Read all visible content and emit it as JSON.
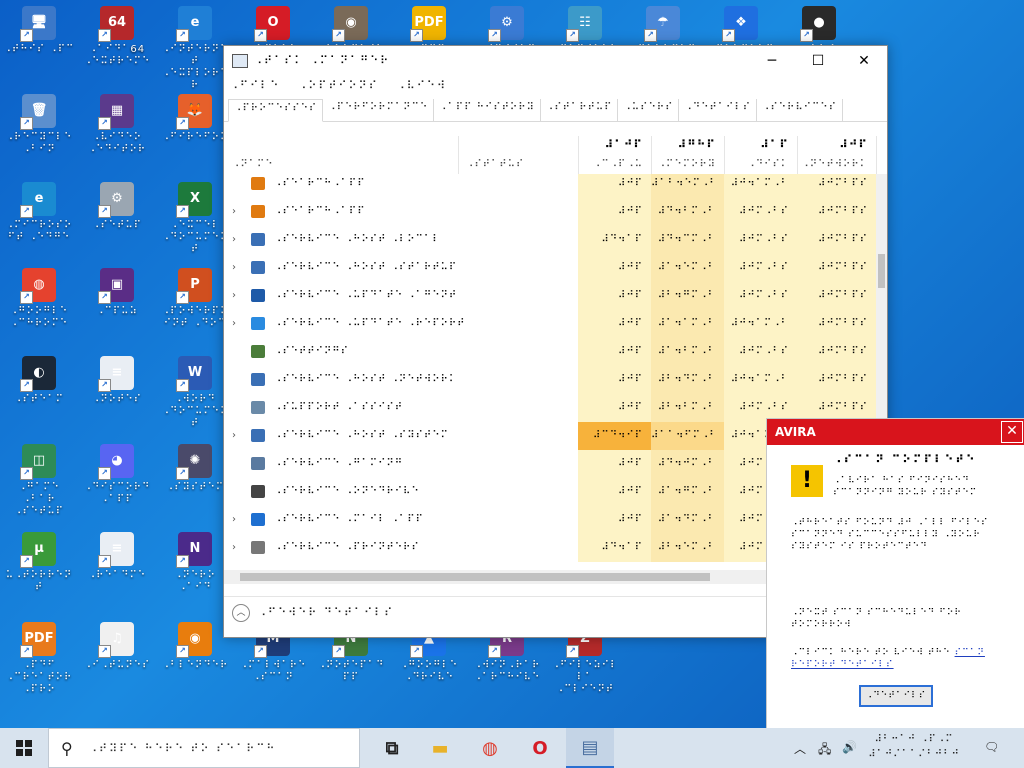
{
  "desktop": {
    "icons": [
      {
        "label": "⠠⠞⠓⠊⠎ ⠠⠏⠉",
        "glyph": "🖥",
        "color": "#3b78c9"
      },
      {
        "label": "⠠⠁⠊⠙⠁64 ⠠⠑⠭⠞⠗⠑⠍⠑",
        "glyph": "64",
        "color": "#b5282b"
      },
      {
        "label": "⠠⠊⠝⠞⠑⠗⠝⠑⠞ ⠠⠑⠭⠏⠇⠕⠗⠑⠗",
        "glyph": "e",
        "color": "#1f7fd6"
      },
      {
        "label": "⠠⠕⠏⠑⠗⠁ ⠠⠃⠗⠕⠺⠎⠑⠗",
        "glyph": "O",
        "color": "#d51c26"
      },
      {
        "label": "⠠⠃⠥⠗⠝⠁⠺⠁⠗⠑",
        "glyph": "◉",
        "color": "#7a6a58"
      },
      {
        "label": "⠠⠏⠙⠋ ⠠⠋⠁⠉⠞⠕⠗⠽",
        "glyph": "PDF",
        "color": "#f0b400"
      },
      {
        "label": "⠠⠎⠽⠎⠞⠑⠍ ⠠⠝⠋⠕",
        "glyph": "⚙",
        "color": "#3a7bd4"
      },
      {
        "label": "⠠⠉⠕⠝⠞⠗⠕⠇ ⠠⠏⠁⠝⠑⠇",
        "glyph": "☷",
        "color": "#3c9ac9"
      },
      {
        "label": "⠠⠏⠁⠗⠁⠛⠕⠝ ⠠⠃⠁⠉⠅⠥⠏",
        "glyph": "☂",
        "color": "#4a88d8"
      },
      {
        "label": "⠠⠙⠗⠕⠏⠃⠕⠭",
        "glyph": "❖",
        "color": "#1f6fe0"
      },
      {
        "label": "⠠⠕⠃⠎ ⠠⠎⠞⠥⠙⠊⠕",
        "glyph": "●",
        "color": "#2a2a2a"
      },
      {
        "label": "⠠⠗⠑⠉⠽⠉⠇⠑ ⠠⠃⠊⠝",
        "glyph": "🗑",
        "color": "#5b8fce"
      },
      {
        "label": "⠠⠧⠊⠙⠑⠕ ⠠⠑⠙⠊⠞⠕⠗",
        "glyph": "▦",
        "color": "#5b3a8c"
      },
      {
        "label": "⠠⠋⠊⠗⠑⠋⠕⠭",
        "glyph": "🦊",
        "color": "#e6602b"
      },
      {
        "label": "⠠⠍⠊⠉⠗⠕⠎⠕⠋⠞ ⠠⠑⠙⠛⠑",
        "glyph": "e",
        "color": "#1a8bd1"
      },
      {
        "label": "⠠⠎⠑⠞⠥⠏",
        "glyph": "⚙",
        "color": "#9aa6b2"
      },
      {
        "label": "⠠⠑⠭⠉⠑⠇ ⠠⠙⠕⠉⠥⠍⠑⠝⠞",
        "glyph": "X",
        "color": "#1d7a3c"
      },
      {
        "label": "⠠⠛⠕⠕⠛⠇⠑ ⠠⠉⠓⠗⠕⠍⠑",
        "glyph": "◍",
        "color": "#e5422e"
      },
      {
        "label": "⠠⠉⠏⠥⠵",
        "glyph": "▣",
        "color": "#5a2d86"
      },
      {
        "label": "⠠⠏⠕⠺⠑⠗⠏⠕⠊⠝⠞ ⠠⠙⠕⠉",
        "glyph": "P",
        "color": "#d04f1f"
      },
      {
        "label": "⠠⠎⠞⠑⠁⠍",
        "glyph": "◐",
        "color": "#1b2838"
      },
      {
        "label": "⠠⠝⠕⠞⠑⠎",
        "glyph": "≡",
        "color": "#e9eef4"
      },
      {
        "label": "⠠⠺⠕⠗⠙ ⠠⠙⠕⠉⠥⠍⠑⠝⠞",
        "glyph": "W",
        "color": "#2b5bb5"
      },
      {
        "label": "⠠⠛⠁⠍⠑ ⠠⠃⠁⠗ ⠠⠎⠑⠞⠥⠏",
        "glyph": "◫",
        "color": "#2e8b57"
      },
      {
        "label": "⠠⠙⠊⠎⠉⠕⠗⠙ ⠠⠁⠏⠏",
        "glyph": "◕",
        "color": "#5865f2"
      },
      {
        "label": "⠠⠎⠽⠎⠞⠑⠍",
        "glyph": "✺",
        "color": "#4a4a6a"
      },
      {
        "label": "⠥⠠⠞⠕⠗⠗⠑⠝⠞",
        "glyph": "µ",
        "color": "#3a9a3a"
      },
      {
        "label": "⠠⠗⠑⠁⠙⠍⠑",
        "glyph": "≡",
        "color": "#e9eef4"
      },
      {
        "label": "⠠⠝⠑⠗⠕ ⠠⠁⠊⠙",
        "glyph": "N",
        "color": "#4b2a8a"
      },
      {
        "label": "⠠⠏⠙⠋ ⠠⠉⠗⠑⠁⠞⠕⠗ ⠠⠏⠗⠕",
        "glyph": "PDF",
        "color": "#e87a1c"
      },
      {
        "label": "⠠⠊⠠⠞⠥⠝⠑⠎",
        "glyph": "♫",
        "color": "#f0f0f0"
      },
      {
        "label": "⠠⠃⠇⠑⠝⠙⠑⠗",
        "glyph": "◉",
        "color": "#e87d0d"
      },
      {
        "label": "⠠⠍⠁⠇⠺⠁⠗⠑ ⠠⠎⠉⠁⠝",
        "glyph": "M",
        "color": "#1e3c78"
      },
      {
        "label": "⠠⠝⠕⠞⠑⠏⠁⠙⠏⠏",
        "glyph": "N",
        "color": "#3d7a3d"
      },
      {
        "label": "⠠⠛⠕⠕⠛⠇⠑ ⠠⠙⠗⠊⠧⠑",
        "glyph": "▲",
        "color": "#1a73e8"
      },
      {
        "label": "⠠⠺⠊⠝⠠⠗⠁⠗ ⠠⠁⠗⠉⠓⠊⠧⠑",
        "glyph": "R",
        "color": "#7a3a8a"
      },
      {
        "label": "⠠⠋⠊⠇⠑⠵⠊⠇⠇⠁ ⠠⠉⠇⠊⠑⠝⠞",
        "glyph": "Z",
        "color": "#b52a2a"
      }
    ]
  },
  "taskmanager": {
    "title": "⠠⠞⠁⠎⠅ ⠠⠍⠁⠝⠁⠛⠑⠗",
    "controls": {
      "minimize": "─",
      "maximize": "☐",
      "close": "✕"
    },
    "menu": [
      "⠠⠋⠊⠇⠑",
      "⠠⠕⠏⠞⠊⠕⠝⠎",
      "⠠⠧⠊⠑⠺"
    ],
    "tabs": [
      "⠠⠏⠗⠕⠉⠑⠎⠎⠑⠎",
      "⠠⠏⠑⠗⠋⠕⠗⠍⠁⠝⠉⠑",
      "⠠⠁⠏⠏ ⠓⠊⠎⠞⠕⠗⠽",
      "⠠⠎⠞⠁⠗⠞⠥⠏",
      "⠠⠥⠎⠑⠗⠎",
      "⠠⠙⠑⠞⠁⠊⠇⠎",
      "⠠⠎⠑⠗⠧⠊⠉⠑⠎"
    ],
    "columns": {
      "name": "⠠⠝⠁⠍⠑",
      "status": "⠠⠎⠞⠁⠞⠥⠎",
      "cpu": {
        "pct": "⠼⠁⠚⠏",
        "label": "⠠⠉⠠⠏⠠⠥"
      },
      "memory": {
        "pct": "⠼⠛⠓⠏",
        "label": "⠠⠍⠑⠍⠕⠗⠽"
      },
      "disk": {
        "pct": "⠼⠁⠏",
        "label": "⠠⠙⠊⠎⠅"
      },
      "network": {
        "pct": "⠼⠚⠏",
        "label": "⠠⠝⠑⠞⠺⠕⠗⠅"
      }
    },
    "rows": [
      {
        "name": "⠠⠎⠑⠁⠗⠉⠓⠠⠁⠏⠏",
        "cpu": "⠼⠚⠏",
        "mem": "⠼⠁⠃⠲⠑⠍⠠⠃",
        "disk": "⠼⠚⠲⠁⠍⠠⠃",
        "net": "⠼⠚⠍⠃⠏⠎",
        "expand": false,
        "icon": "#e07a10"
      },
      {
        "name": "⠠⠎⠑⠁⠗⠉⠓⠠⠁⠏⠏",
        "cpu": "⠼⠚⠏",
        "mem": "⠼⠙⠲⠃⠍⠠⠃",
        "disk": "⠼⠚⠍⠠⠃⠎",
        "net": "⠼⠚⠍⠃⠏⠎",
        "expand": true,
        "icon": "#e07a10"
      },
      {
        "name": "⠠⠎⠑⠗⠧⠊⠉⠑ ⠠⠓⠕⠎⠞ ⠠⠇⠕⠉⠁⠇",
        "cpu": "⠼⠙⠲⠁⠏",
        "mem": "⠼⠙⠲⠉⠍⠠⠃",
        "disk": "⠼⠚⠍⠠⠃⠎",
        "net": "⠼⠚⠍⠃⠏⠎",
        "expand": true,
        "icon": "#3a6fb5"
      },
      {
        "name": "⠠⠎⠑⠗⠧⠊⠉⠑ ⠠⠓⠕⠎⠞ ⠠⠎⠞⠁⠗⠞⠥⠏",
        "cpu": "⠼⠚⠏",
        "mem": "⠼⠁⠲⠑⠍⠠⠃",
        "disk": "⠼⠚⠍⠠⠃⠎",
        "net": "⠼⠚⠍⠃⠏⠎",
        "expand": true,
        "icon": "#3a6fb5"
      },
      {
        "name": "⠠⠎⠑⠗⠧⠊⠉⠑ ⠠⠥⠏⠙⠁⠞⠑ ⠠⠁⠛⠑⠝⠞",
        "cpu": "⠼⠚⠏",
        "mem": "⠼⠃⠲⠛⠍⠠⠃",
        "disk": "⠼⠚⠍⠠⠃⠎",
        "net": "⠼⠚⠍⠃⠏⠎",
        "expand": true,
        "icon": "#1e5aa8"
      },
      {
        "name": "⠠⠎⠑⠗⠧⠊⠉⠑ ⠠⠥⠏⠙⠁⠞⠑ ⠠⠗⠑⠏⠕⠗⠞",
        "cpu": "⠼⠚⠏",
        "mem": "⠼⠁⠲⠁⠍⠠⠃",
        "disk": "⠼⠚⠲⠁⠍⠠⠃",
        "net": "⠼⠚⠍⠃⠏⠎",
        "expand": true,
        "icon": "#2a8be0"
      },
      {
        "name": "⠠⠎⠑⠞⠞⠊⠝⠛⠎",
        "cpu": "⠼⠚⠏",
        "mem": "⠼⠁⠲⠃⠍⠠⠃",
        "disk": "⠼⠚⠍⠠⠃⠎",
        "net": "⠼⠚⠍⠃⠏⠎",
        "expand": false,
        "icon": "#4b7d3a"
      },
      {
        "name": "⠠⠎⠑⠗⠧⠊⠉⠑ ⠠⠓⠕⠎⠞ ⠠⠝⠑⠞⠺⠕⠗⠅",
        "cpu": "⠼⠚⠏",
        "mem": "⠼⠃⠲⠙⠍⠠⠃",
        "disk": "⠼⠚⠲⠁⠍⠠⠃",
        "net": "⠼⠚⠍⠃⠏⠎",
        "expand": false,
        "icon": "#3a6fb5"
      },
      {
        "name": "⠠⠎⠥⠏⠏⠕⠗⠞ ⠠⠁⠎⠎⠊⠎⠞",
        "cpu": "⠼⠚⠏",
        "mem": "⠼⠃⠲⠃⠍⠠⠃",
        "disk": "⠼⠚⠍⠠⠃⠎",
        "net": "⠼⠚⠍⠃⠏⠎",
        "expand": false,
        "icon": "#6a8aa8"
      },
      {
        "name": "⠠⠎⠑⠗⠧⠊⠉⠑ ⠠⠓⠕⠎⠞ ⠠⠎⠽⠎⠞⠑⠍",
        "cpu": "⠼⠉⠙⠲⠊⠏",
        "mem": "⠼⠁⠁⠲⠋⠍⠠⠃",
        "disk": "⠼⠚⠲⠁⠍⠠⠃",
        "net": "⠼⠚⠍⠃⠏⠎",
        "expand": true,
        "icon": "#3a6fb5",
        "hot": true
      },
      {
        "name": "⠠⠎⠑⠗⠧⠊⠉⠑ ⠠⠛⠁⠍⠊⠝⠛",
        "cpu": "⠼⠚⠏",
        "mem": "⠼⠙⠲⠚⠍⠠⠃",
        "disk": "⠼⠚⠍⠠⠃⠎",
        "net": "⠼⠚⠍⠃⠏⠎",
        "expand": false,
        "icon": "#5a7aa0"
      },
      {
        "name": "⠠⠎⠑⠗⠧⠊⠉⠑ ⠠⠕⠝⠑⠙⠗⠊⠧⠑",
        "cpu": "⠼⠚⠏",
        "mem": "⠼⠁⠲⠛⠍⠠⠃",
        "disk": "⠼⠚⠍⠠⠃⠎",
        "net": "⠼⠚⠍⠃⠏⠎",
        "expand": false,
        "icon": "#444"
      },
      {
        "name": "⠠⠎⠑⠗⠧⠊⠉⠑ ⠠⠍⠁⠊⠇ ⠠⠁⠏⠏",
        "cpu": "⠼⠚⠏",
        "mem": "⠼⠁⠲⠙⠍⠠⠃",
        "disk": "⠼⠚⠍⠠⠃⠎",
        "net": "⠼⠚⠍⠃⠏⠎",
        "expand": true,
        "icon": "#1e6fd0"
      },
      {
        "name": "⠠⠎⠑⠗⠧⠊⠉⠑ ⠠⠏⠗⠊⠝⠞⠑⠗⠎",
        "cpu": "⠼⠙⠲⠁⠏",
        "mem": "⠼⠃⠲⠑⠍⠠⠃",
        "disk": "⠼⠚⠍⠠⠃⠎",
        "net": "⠼⠚⠍⠃⠏⠎",
        "expand": true,
        "icon": "#777"
      }
    ],
    "footer": "⠠⠋⠑⠺⠑⠗ ⠙⠑⠞⠁⠊⠇⠎"
  },
  "avira": {
    "brand": "AVIRA",
    "close": "✕",
    "title": "⠠⠎⠉⠁⠝ ⠉⠕⠍⠏⠇⠑⠞⠑",
    "intro": "⠠⠁⠧⠊⠗⠁ ⠓⠁⠎ ⠋⠊⠝⠊⠎⠓⠑⠙ ⠎⠉⠁⠝⠝⠊⠝⠛ ⠽⠕⠥⠗ ⠎⠽⠎⠞⠑⠍",
    "body1": "⠠⠞⠓⠗⠑⠁⠞⠎ ⠋⠕⠥⠝⠙ ⠼⠚ ⠠⠁⠇⠇ ⠋⠊⠇⠑⠎ ⠎⠉⠁⠝⠝⠑⠙ ⠎⠥⠉⠉⠑⠎⠎⠋⠥⠇⠇⠽ ⠠⠽⠕⠥⠗ ⠎⠽⠎⠞⠑⠍ ⠊⠎ ⠏⠗⠕⠞⠑⠉⠞⠑⠙",
    "body2": "⠠⠝⠑⠭⠞ ⠎⠉⠁⠝ ⠎⠉⠓⠑⠙⠥⠇⠑⠙ ⠋⠕⠗ ⠞⠕⠍⠕⠗⠗⠕⠺",
    "body3": "⠠⠉⠇⠊⠉⠅ ⠓⠑⠗⠑ ⠞⠕ ⠧⠊⠑⠺ ⠞⠓⠑",
    "link": "⠎⠉⠁⠝ ⠗⠑⠏⠕⠗⠞ ⠙⠑⠞⠁⠊⠇⠎",
    "button": "⠠⠙⠑⠞⠁⠊⠇⠎"
  },
  "taskbar": {
    "search_placeholder": "⠠⠞⠽⠏⠑ ⠓⠑⠗⠑ ⠞⠕ ⠎⠑⠁⠗⠉⠓",
    "apps": [
      {
        "name": "task-view",
        "glyph": "⧉",
        "color": "#222"
      },
      {
        "name": "file-explorer",
        "glyph": "▬",
        "color": "#e8b22a"
      },
      {
        "name": "chrome",
        "glyph": "◍",
        "color": "#de3b2c"
      },
      {
        "name": "opera",
        "glyph": "O",
        "color": "#d51c26"
      },
      {
        "name": "task-manager",
        "glyph": "▤",
        "color": "#4a6fa0"
      }
    ],
    "tray": {
      "chevron": "︿",
      "network": "🖧",
      "volume": "🔊",
      "notifications": "🗨"
    },
    "clock": {
      "time": "⠼⠃⠒⠁⠚ ⠠⠏⠠⠍",
      "date": "⠼⠁⠚⠌⠁⠁⠌⠃⠚⠃⠚"
    }
  }
}
